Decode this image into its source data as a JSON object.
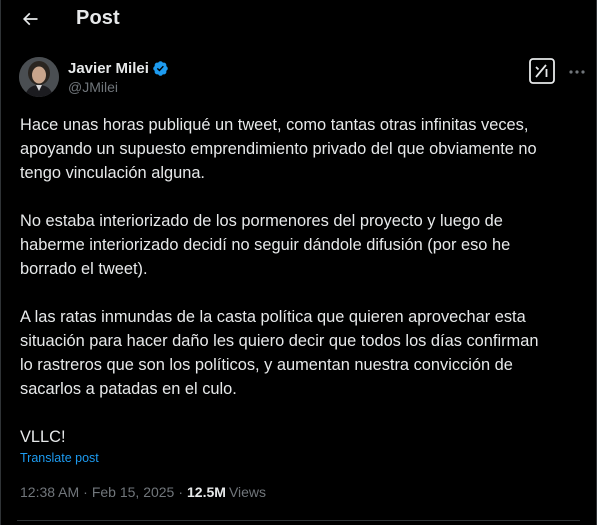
{
  "header": {
    "title": "Post",
    "back_icon": "arrow-left-icon"
  },
  "author": {
    "name": "Javier Milei",
    "handle": "@JMilei",
    "verified": true,
    "verified_color": "#1d9bf0"
  },
  "actions": {
    "grok_icon": "grok-icon",
    "more_icon": "more-horizontal-icon"
  },
  "tweet": {
    "paragraphs": [
      "Hace unas horas publiqué un tweet, como tantas otras infinitas veces,\napoyando un supuesto emprendimiento privado del que obviamente no\ntengo vinculación alguna.",
      "No estaba interiorizado de los pormenores del proyecto y luego de\nhaberme interiorizado decidí no seguir dándole difusión (por eso he\nborrado el tweet).",
      "A las ratas inmundas de la casta política que quieren aprovechar esta\nsituación para hacer daño les quiero decir que todos los días confirman\nlo rastreros que son los políticos, y aumentan nuestra convicción de\nsacarlos a patadas en el culo.",
      "VLLC!"
    ],
    "translate_label": "Translate post"
  },
  "meta": {
    "time": "12:38 AM",
    "separator": "·",
    "date": "Feb 15, 2025",
    "views_count": "12.5M",
    "views_label": "Views"
  },
  "colors": {
    "background": "#000000",
    "text": "#e7e9ea",
    "secondary": "#71767b",
    "link": "#1d9bf0",
    "border": "#2f3336"
  }
}
